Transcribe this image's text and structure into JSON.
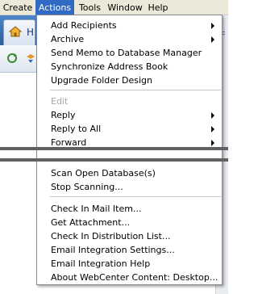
{
  "menubar": {
    "items": [
      {
        "label": "Create"
      },
      {
        "label": "Actions"
      },
      {
        "label": "Tools"
      },
      {
        "label": "Window"
      },
      {
        "label": "Help"
      }
    ]
  },
  "app": {
    "home_tab_label": "H"
  },
  "actions_menu": {
    "group1": [
      {
        "label": "Add Recipients"
      },
      {
        "label": "Archive"
      },
      {
        "label": "Send Memo to Database Manager"
      },
      {
        "label": "Synchronize Address Book"
      },
      {
        "label": "Upgrade Folder Design"
      }
    ],
    "group2": [
      {
        "label": "Edit"
      },
      {
        "label": "Reply"
      },
      {
        "label": "Reply to All"
      },
      {
        "label": "Forward"
      }
    ],
    "group3": [
      {
        "label": "Scan Open Database(s)"
      },
      {
        "label": "Stop Scanning..."
      }
    ],
    "group4": [
      {
        "label": "Check In Mail Item..."
      },
      {
        "label": "Get Attachment..."
      },
      {
        "label": "Check In Distribution List..."
      },
      {
        "label": "Email Integration Settings..."
      },
      {
        "label": "Email Integration Help"
      },
      {
        "label": "About WebCenter Content: Desktop..."
      }
    ]
  },
  "colors": {
    "menu_highlight": "#316ac5",
    "disabled_text": "#a7a6aa",
    "menubar_bg": "#ece9d8"
  }
}
